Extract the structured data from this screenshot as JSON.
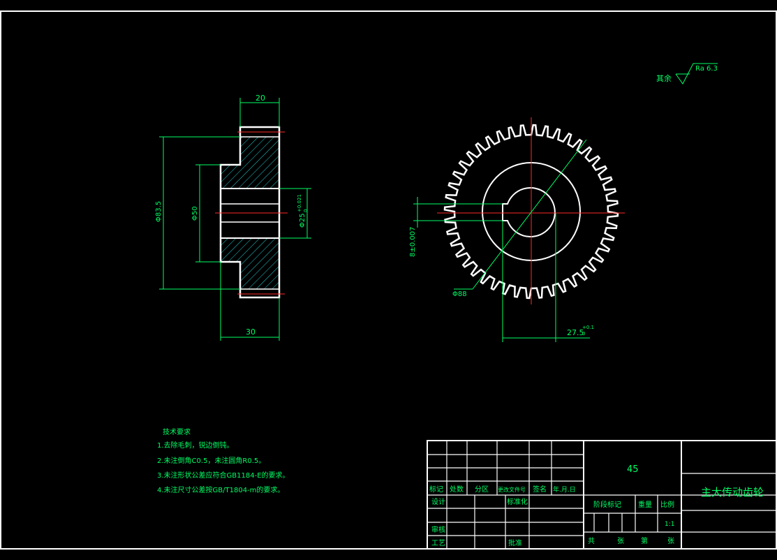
{
  "drawing": {
    "dims": {
      "hub_width": "20",
      "total_width": "30",
      "tip_diameter": "Φ83.5",
      "hub_diameter": "Φ50",
      "bore_diameter": "Φ25",
      "bore_tolerance_upper": "+0.021",
      "bore_tolerance_lower": "0",
      "circle_diameter": "Φ88",
      "keyway_width": "8±0.007",
      "keyway_depth": "27.5",
      "keyway_depth_tol_upper": "+0.1",
      "keyway_depth_tol_lower": "0"
    },
    "roughness": {
      "label": "其余",
      "value": "Ra 6.3"
    },
    "gear": {
      "teeth": 44
    }
  },
  "notes": {
    "title": "技术要求",
    "items": [
      "1.去除毛刺，锐边倒钝。",
      "2.未注倒角C0.5，未注圆角R0.5。",
      "3.未注形状公差应符合GB1184-E的要求。",
      "4.未注尺寸公差按GB/T1804-m的要求。"
    ]
  },
  "title_block": {
    "material": "45",
    "part_name": "主大传动齿轮",
    "revision_headers": [
      "标记",
      "处数",
      "分区",
      "更改文件号",
      "签名",
      "年.月.日"
    ],
    "design": "设计",
    "standardize": "标准化",
    "review": "审核",
    "process": "工艺",
    "approve": "批准",
    "stage_mark": "阶段标记",
    "weight": "重量",
    "scale": "比例",
    "scale_value": "1:1",
    "sheet_total": "共",
    "sheet_unit": "张",
    "sheet_no": "第",
    "sheet_unit2": "张"
  },
  "colors": {
    "outline": "#ffffff",
    "dimension": "#00ff66",
    "centerline": "#ff2a2a",
    "hatch": "#22cccc"
  }
}
